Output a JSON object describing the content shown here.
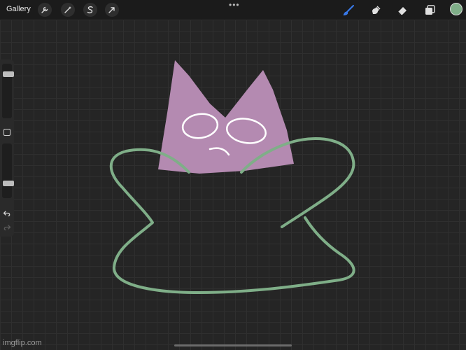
{
  "topbar": {
    "gallery_label": "Gallery",
    "left_tools": [
      "wrench-icon",
      "magic-wand-icon",
      "selection-s-icon",
      "transform-arrow-icon"
    ],
    "more_label": "•••",
    "right_tools": [
      "brush-icon",
      "smudge-icon",
      "eraser-icon",
      "layers-icon"
    ],
    "active_tool": "brush-icon",
    "accent_color": "#3a7cf0",
    "current_color": "#7fae88"
  },
  "sidebar": {
    "brush_size_level": 0.85,
    "opacity_level": 0.25
  },
  "artwork": {
    "cat_color": "#b48ab1",
    "outline_color": "#7fae88",
    "face_color": "#ffffff"
  },
  "watermark": "imgflip.com"
}
